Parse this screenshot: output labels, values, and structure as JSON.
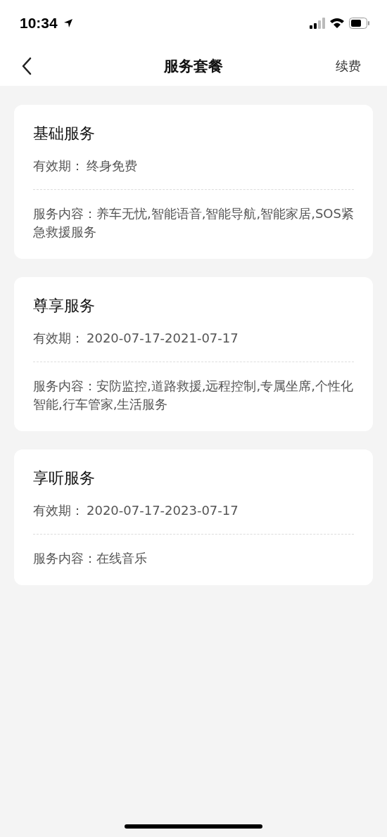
{
  "status_bar": {
    "time": "10:34"
  },
  "nav": {
    "title": "服务套餐",
    "action": "续费"
  },
  "cards": [
    {
      "title": "基础服务",
      "validity_label": "有效期：",
      "validity": "终身免费",
      "content_label": "服务内容：",
      "content": "养车无忧,智能语音,智能导航,智能家居,SOS紧急救援服务"
    },
    {
      "title": "尊享服务",
      "validity_label": "有效期：",
      "validity": "2020-07-17-2021-07-17",
      "content_label": "服务内容：",
      "content": "安防监控,道路救援,远程控制,专属坐席,个性化智能,行车管家,生活服务"
    },
    {
      "title": "享听服务",
      "validity_label": "有效期：",
      "validity": "2020-07-17-2023-07-17",
      "content_label": "服务内容：",
      "content": "在线音乐"
    }
  ]
}
